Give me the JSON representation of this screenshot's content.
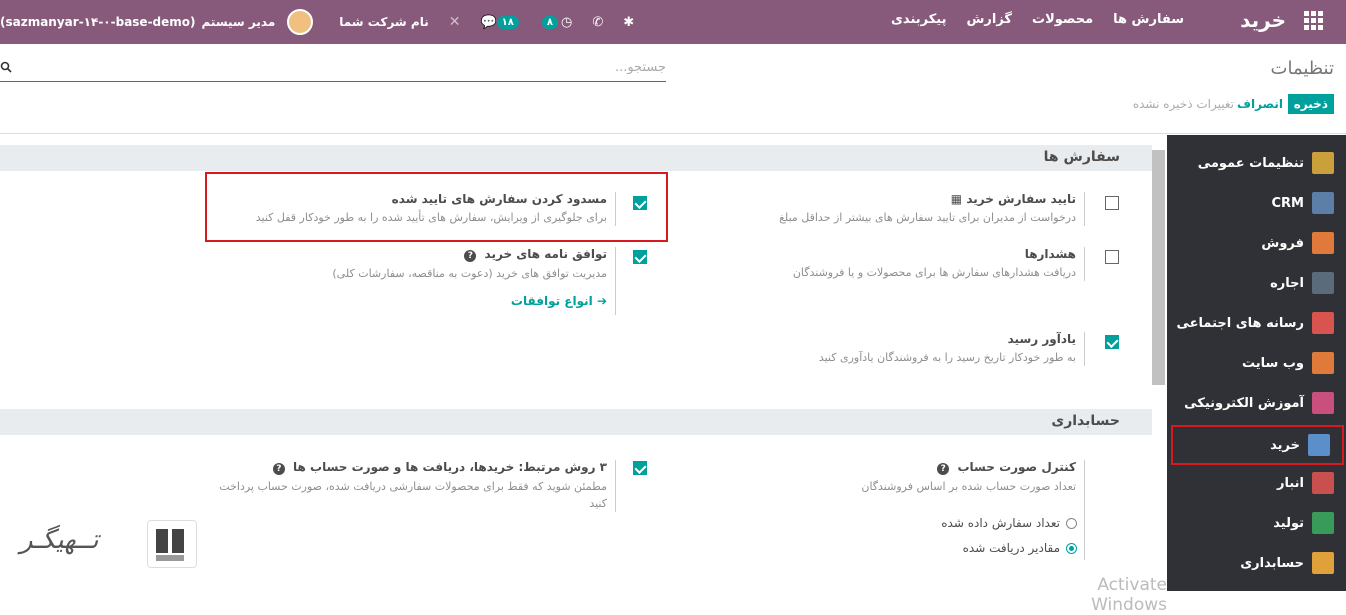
{
  "navbar": {
    "brand": "خرید",
    "menu": [
      "سفارش ها",
      "محصولات",
      "گزارش",
      "پیکربندی"
    ],
    "company": "نام شرکت شما",
    "chat_count": "۱۸",
    "activity_count": "۸",
    "user": "مدیر سیستم",
    "db": "(sazmanyar-۱۴-۰-base-demo)"
  },
  "control_panel": {
    "title": "تنظیمات",
    "search_placeholder": "جستجو...",
    "save": "ذخیره",
    "discard": "انصراف",
    "unsaved": "تغییرات ذخیره نشده"
  },
  "sidebar": {
    "items": [
      {
        "label": "تنظیمات عمومی",
        "icon": "gear-icon",
        "color": "#c9a03a"
      },
      {
        "label": "CRM",
        "icon": "handshake-icon",
        "color": "#5b7fa6"
      },
      {
        "label": "فروش",
        "icon": "chart-icon",
        "color": "#e07a3a"
      },
      {
        "label": "اجاره",
        "icon": "calendar-icon",
        "color": "#5a6b7c"
      },
      {
        "label": "رسانه های اجتماعی",
        "icon": "thumbs-up-icon",
        "color": "#d9534f"
      },
      {
        "label": "وب سایت",
        "icon": "globe-icon",
        "color": "#e07a3a"
      },
      {
        "label": "آموزش الکترونیکی",
        "icon": "elearning-icon",
        "color": "#c94f7c"
      },
      {
        "label": "خرید",
        "icon": "purchase-icon",
        "color": "#5b8fc9"
      },
      {
        "label": "انبار",
        "icon": "box-icon",
        "color": "#c9504f"
      },
      {
        "label": "تولید",
        "icon": "wrench-icon",
        "color": "#3a9a5a"
      },
      {
        "label": "حسابداری",
        "icon": "invoice-icon",
        "color": "#e0a03a"
      }
    ]
  },
  "sections": {
    "orders": {
      "title": "سفارش ها",
      "settings": {
        "approval": {
          "title": "تایید سفارش خرید",
          "desc": "درخواست از مدیران برای تایید سفارش های بیشتر از حداقل مبلغ",
          "checked": false
        },
        "lock": {
          "title": "مسدود کردن سفارش های تایید شده",
          "desc": "برای جلوگیری از ویرایش، سفارش های تأیید شده را به طور خودکار قفل کنید",
          "checked": true
        },
        "warnings": {
          "title": "هشدارها",
          "desc": "دریافت هشدارهای سفارش ها برای محصولات و یا فروشندگان",
          "checked": false
        },
        "agreements": {
          "title": "توافق نامه های خرید",
          "desc": "مدیریت توافق های خرید (دعوت به مناقصه، سفارشات کلی)",
          "link": "انواع توافقات",
          "checked": true
        },
        "reminder": {
          "title": "یادآور رسید",
          "desc": "به طور خودکار تاریخ رسید را به فروشندگان یادآوری کنید",
          "checked": true
        }
      }
    },
    "accounting": {
      "title": "حسابداری",
      "settings": {
        "bill_control": {
          "title": "کنترل صورت حساب",
          "desc": "تعداد صورت حساب شده بر اساس فروشندگان",
          "options": [
            "تعداد سفارش داده شده",
            "مقادیر دریافت شده"
          ],
          "selected": 1
        },
        "three_way": {
          "title": "۳ روش مرتبط: خریدها، دریافت ها و صورت حساب ها",
          "desc": "مطمئن شوید که فقط برای محصولات سفارشی دریافت شده، صورت حساب پرداخت کنید",
          "checked": true
        }
      }
    }
  },
  "watermark": "تــهیگـر",
  "activate_windows": "Activate Windows"
}
